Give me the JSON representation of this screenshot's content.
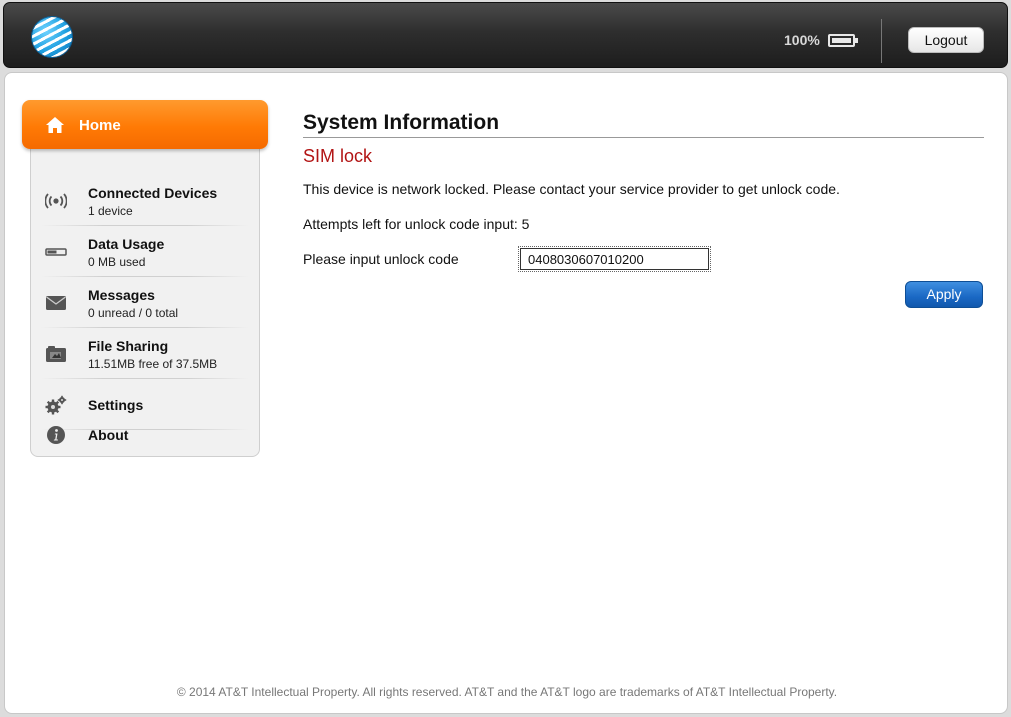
{
  "header": {
    "logo": "att-globe-logo",
    "battery_percent": "100%",
    "battery_icon": "battery-full-icon",
    "logout_label": "Logout"
  },
  "sidebar": {
    "home": {
      "label": "Home",
      "icon": "home-icon"
    },
    "items": [
      {
        "title": "Connected Devices",
        "sub": "1 device",
        "icon": "wireless-signal-icon"
      },
      {
        "title": "Data Usage",
        "sub": "0 MB used",
        "icon": "data-usage-icon"
      },
      {
        "title": "Messages",
        "sub": "0 unread / 0 total",
        "icon": "envelope-icon"
      },
      {
        "title": "File Sharing",
        "sub": "11.51MB free of 37.5MB",
        "icon": "file-sharing-icon"
      },
      {
        "title": "Settings",
        "icon": "gear-icon"
      },
      {
        "title": "About",
        "icon": "info-icon"
      }
    ]
  },
  "main": {
    "title": "System Information",
    "section": "SIM lock",
    "message": "This device is network locked. Please contact your service provider to get unlock code.",
    "attempts": "Attempts left for unlock code input: 5",
    "unlock_label": "Please input unlock code",
    "unlock_value": "0408030607010200",
    "apply_label": "Apply"
  },
  "footer": {
    "text": "© 2014 AT&T Intellectual Property. All rights reserved. AT&T and the AT&T logo are trademarks of AT&T Intellectual Property."
  },
  "colors": {
    "accent_orange": "#ff7a05",
    "error_red": "#b21414",
    "button_blue": "#1a68c4"
  }
}
